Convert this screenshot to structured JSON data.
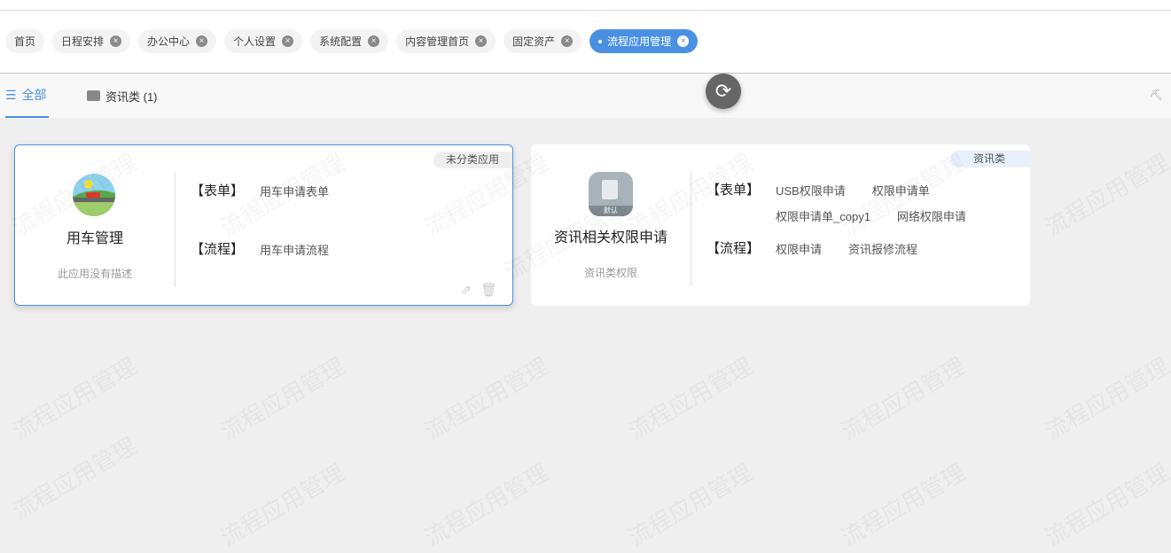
{
  "tabs": [
    {
      "label": "首页",
      "closable": false,
      "active": false
    },
    {
      "label": "日程安排",
      "closable": true,
      "active": false
    },
    {
      "label": "办公中心",
      "closable": true,
      "active": false
    },
    {
      "label": "个人设置",
      "closable": true,
      "active": false
    },
    {
      "label": "系统配置",
      "closable": true,
      "active": false
    },
    {
      "label": "内容管理首页",
      "closable": true,
      "active": false
    },
    {
      "label": "固定资产",
      "closable": true,
      "active": false
    },
    {
      "label": "流程应用管理",
      "closable": true,
      "active": true
    }
  ],
  "subtabs": {
    "all": "全部",
    "news": "资讯类 (1)"
  },
  "watermark": "流程应用管理",
  "cards": [
    {
      "badge": "未分类应用",
      "name": "用车管理",
      "desc": "此应用没有描述",
      "form_label": "【表单】",
      "forms": [
        "用车申请表单"
      ],
      "flow_label": "【流程】",
      "flows": [
        "用车申请流程"
      ]
    },
    {
      "badge": "资讯类",
      "name": "资讯相关权限申请",
      "desc": "资讯类权限",
      "icon_tag": "默认",
      "form_label": "【表单】",
      "forms": [
        "USB权限申请",
        "权限申请单",
        "权限申请单_copy1",
        "网络权限申请"
      ],
      "flow_label": "【流程】",
      "flows": [
        "权限申请",
        "资讯报修流程"
      ]
    }
  ],
  "colors": {
    "accent": "#4a90e2"
  }
}
